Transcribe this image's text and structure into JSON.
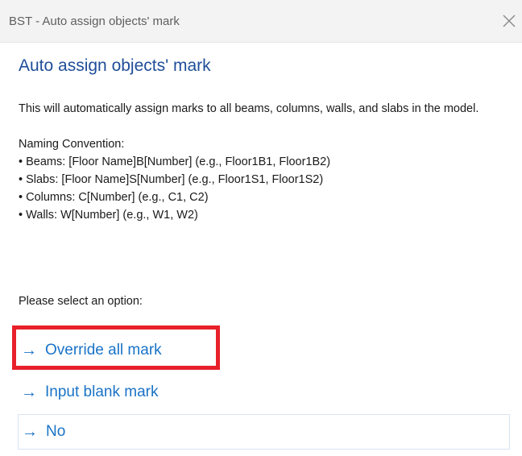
{
  "window": {
    "title": "BST - Auto assign objects' mark",
    "close_glyph": "✕"
  },
  "dialog": {
    "main_instruction": "Auto assign objects' mark",
    "description": "This will automatically assign marks to all beams, columns, walls, and slabs in the model.",
    "naming_heading": "Naming Convention:",
    "conventions": [
      "• Beams: [Floor Name]B[Number] (e.g., Floor1B1, Floor1B2)",
      "• Slabs: [Floor Name]S[Number] (e.g., Floor1S1, Floor1S2)",
      "• Columns: C[Number] (e.g., C1, C2)",
      "• Walls: W[Number] (e.g., W1, W2)"
    ],
    "prompt": "Please select an option:",
    "arrow_glyph": "→",
    "options": {
      "override": "Override all mark",
      "blank": "Input blank mark",
      "no": "No"
    }
  },
  "icons": {
    "close": "close-icon",
    "arrow": "arrow-right-icon"
  },
  "colors": {
    "titlebar_bg": "#f3f3f3",
    "heading": "#1f4e99",
    "link": "#1a73c7",
    "highlight": "#e8202a"
  }
}
